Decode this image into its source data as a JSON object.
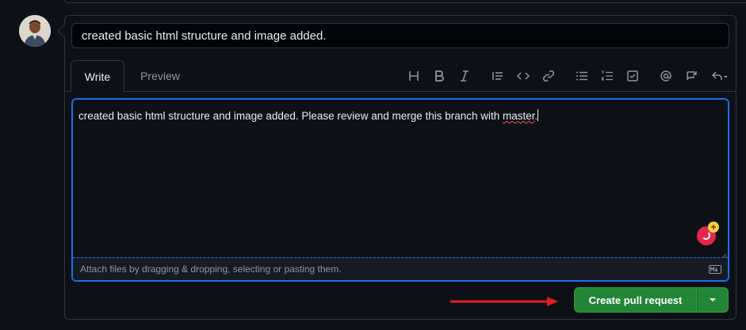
{
  "pr": {
    "title_value": "created basic html structure and image added.",
    "body_text_before": "created basic html structure and image added. Please review and merge this branch with ",
    "body_text_misspelled": "master",
    "body_text_after": "."
  },
  "tabs": {
    "write": "Write",
    "preview": "Preview"
  },
  "toolbar": {
    "icons": [
      "heading-icon",
      "bold-icon",
      "italic-icon",
      "quote-icon",
      "code-icon",
      "link-icon",
      "unordered-list-icon",
      "ordered-list-icon",
      "task-list-icon",
      "mention-icon",
      "cross-reference-icon",
      "saved-replies-icon"
    ]
  },
  "editor": {
    "attach_hint": "Attach files by dragging & dropping, selecting or pasting them."
  },
  "actions": {
    "create_label": "Create pull request"
  },
  "colors": {
    "background": "#0d1117",
    "border": "#30363d",
    "focus": "#1f6feb",
    "primary_button": "#238636",
    "annotation_arrow": "#e11d1d"
  }
}
